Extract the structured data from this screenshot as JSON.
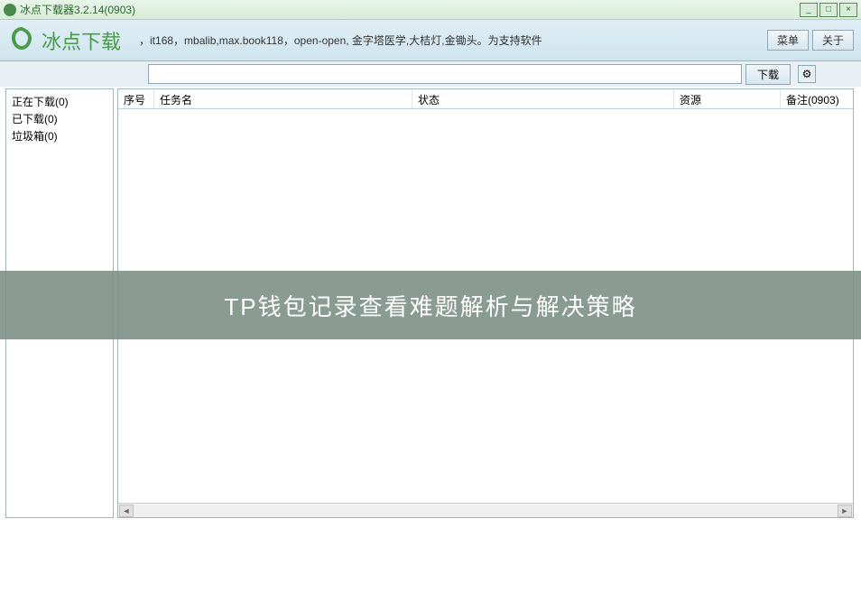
{
  "window": {
    "title": "冰点下载器3.2.14(0903)"
  },
  "header": {
    "logo_text": "冰点下载",
    "subtitle": "，it168，mbalib,max.book118，open-open, 金字塔医学,大桔灯,金锄头。为支持软件",
    "menu_btn": "菜单",
    "about_btn": "关于"
  },
  "search": {
    "value": "",
    "download_btn": "下载"
  },
  "sidebar": {
    "items": [
      {
        "label": "正在下载(0)"
      },
      {
        "label": "已下载(0)"
      },
      {
        "label": "垃圾箱(0)"
      }
    ]
  },
  "table": {
    "columns": {
      "seq": "序号",
      "name": "任务名",
      "status": "状态",
      "resource": "资源",
      "note": "备注(0903)"
    },
    "rows": []
  },
  "overlay": {
    "text": "TP钱包记录查看难题解析与解决策略"
  },
  "glyphs": {
    "minimize": "_",
    "maximize": "□",
    "close": "×",
    "gear": "⚙",
    "arrow_left": "◄",
    "arrow_right": "►"
  }
}
